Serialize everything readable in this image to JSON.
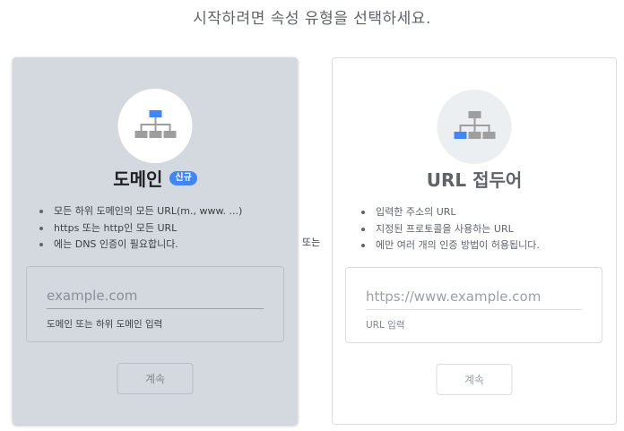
{
  "heading": "시작하려면 속성 유형을 선택하세요.",
  "or_label": "또는",
  "domain_card": {
    "icon": "domain-network-icon",
    "title": "도메인",
    "badge": "신규",
    "features": [
      "모든 하위 도메인의 모든 URL(m., www. ...)",
      "https 또는 http인 모든 URL",
      "에는 DNS 인증이 필요합니다."
    ],
    "input_placeholder": "example.com",
    "input_value": "",
    "input_hint": "도메인 또는 하위 도메인 입력",
    "continue_label": "계속"
  },
  "url_card": {
    "icon": "url-prefix-network-icon",
    "title": "URL 접두어",
    "features": [
      "입력한 주소의 URL",
      "지정된 프로토콜을 사용하는 URL",
      "에만 여러 개의 인증 방법이 허용됩니다."
    ],
    "input_placeholder": "https://www.example.com",
    "input_value": "",
    "input_hint": "URL 입력",
    "continue_label": "계속"
  },
  "colors": {
    "accent_blue": "#4285f4",
    "icon_gray": "#9e9e9e",
    "domain_card_bg": "#d3d9de"
  }
}
